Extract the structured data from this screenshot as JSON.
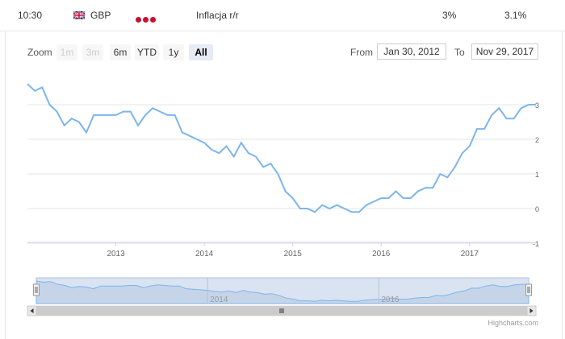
{
  "header": {
    "time": "10:30",
    "currency": "GBP",
    "event": "Inflacja r/r",
    "previous": "3%",
    "actual": "3.1%"
  },
  "range_selector": {
    "zoom_label": "Zoom",
    "buttons": [
      {
        "label": "1m",
        "state": "disabled"
      },
      {
        "label": "3m",
        "state": "disabled"
      },
      {
        "label": "6m",
        "state": "normal"
      },
      {
        "label": "YTD",
        "state": "normal"
      },
      {
        "label": "1y",
        "state": "normal"
      },
      {
        "label": "All",
        "state": "active"
      }
    ],
    "from_label": "From",
    "from_value": "Jan 30, 2012",
    "to_label": "To",
    "to_value": "Nov 29, 2017"
  },
  "navigator": {
    "labels": [
      "2014",
      "2016"
    ]
  },
  "credit": "Highcharts.com",
  "colors": {
    "line": "#7cb5ec",
    "impact": "#c8102e",
    "navigator_fill": "#d9e3f1"
  },
  "chart_data": {
    "type": "line",
    "title": "",
    "xlabel": "",
    "ylabel": "",
    "x_tick_labels": [
      "2013",
      "2014",
      "2015",
      "2016",
      "2017"
    ],
    "y_tick_labels": [
      "3",
      "2",
      "1",
      "0",
      "-1"
    ],
    "ylim": [
      -1,
      3.6
    ],
    "xlim": [
      "2012-01",
      "2017-10"
    ],
    "grid": true,
    "series": [
      {
        "x": [
          "2012-01",
          "2012-02",
          "2012-03",
          "2012-04",
          "2012-05",
          "2012-06",
          "2012-07",
          "2012-08",
          "2012-09",
          "2012-10",
          "2012-11",
          "2012-12",
          "2013-01",
          "2013-02",
          "2013-03",
          "2013-04",
          "2013-05",
          "2013-06",
          "2013-07",
          "2013-08",
          "2013-09",
          "2013-10",
          "2013-11",
          "2013-12",
          "2014-01",
          "2014-02",
          "2014-03",
          "2014-04",
          "2014-05",
          "2014-06",
          "2014-07",
          "2014-08",
          "2014-09",
          "2014-10",
          "2014-11",
          "2014-12",
          "2015-01",
          "2015-02",
          "2015-03",
          "2015-04",
          "2015-05",
          "2015-06",
          "2015-07",
          "2015-08",
          "2015-09",
          "2015-10",
          "2015-11",
          "2015-12",
          "2016-01",
          "2016-02",
          "2016-03",
          "2016-04",
          "2016-05",
          "2016-06",
          "2016-07",
          "2016-08",
          "2016-09",
          "2016-10",
          "2016-11",
          "2016-12",
          "2017-01",
          "2017-02",
          "2017-03",
          "2017-04",
          "2017-05",
          "2017-06",
          "2017-07",
          "2017-08",
          "2017-09",
          "2017-10"
        ],
        "values": [
          3.6,
          3.4,
          3.5,
          3.0,
          2.8,
          2.4,
          2.6,
          2.5,
          2.2,
          2.7,
          2.7,
          2.7,
          2.7,
          2.8,
          2.8,
          2.4,
          2.7,
          2.9,
          2.8,
          2.7,
          2.7,
          2.2,
          2.1,
          2.0,
          1.9,
          1.7,
          1.6,
          1.8,
          1.5,
          1.9,
          1.6,
          1.5,
          1.2,
          1.3,
          1.0,
          0.5,
          0.3,
          0.0,
          0.0,
          -0.1,
          0.1,
          0.0,
          0.1,
          0.0,
          -0.1,
          -0.1,
          0.1,
          0.2,
          0.3,
          0.3,
          0.5,
          0.3,
          0.3,
          0.5,
          0.6,
          0.6,
          1.0,
          0.9,
          1.2,
          1.6,
          1.8,
          2.3,
          2.3,
          2.7,
          2.9,
          2.6,
          2.6,
          2.9,
          3.0,
          3.0
        ]
      }
    ]
  }
}
